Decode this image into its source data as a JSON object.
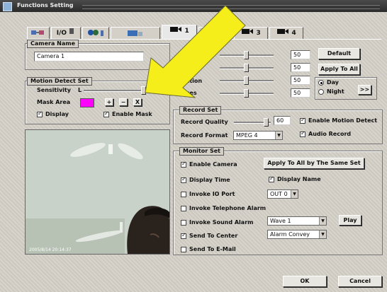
{
  "window": {
    "title": "Functions Setting"
  },
  "tabs": [
    {
      "label": "",
      "icon": "network-icon"
    },
    {
      "label": "I/O",
      "icon": "io-icon"
    },
    {
      "label": "",
      "icon": "users-icon"
    },
    {
      "label": "",
      "icon": "monitor-icon"
    },
    {
      "label": "1",
      "icon": "camera-icon"
    },
    {
      "label": "",
      "icon": "camera-icon"
    },
    {
      "label": "3",
      "icon": "camera-icon"
    },
    {
      "label": "4",
      "icon": "camera-icon"
    }
  ],
  "camera_name": {
    "group_label": "Camera Name",
    "value": "Camera 1"
  },
  "motion_detect": {
    "group_label": "Motion Detect Set",
    "sensitivity_label": "Sensitivity",
    "sensitivity_min": "L",
    "sensitivity_max": "H",
    "sensitivity_level": 0.95,
    "mask_area_label": "Mask Area",
    "mask_color": "#ff00ff",
    "plus_label": "+",
    "minus_label": "−",
    "clear_label": "X",
    "display_label": "Display",
    "display_checked": true,
    "enable_mask_label": "Enable Mask",
    "enable_mask_checked": true
  },
  "image_adjust": {
    "rows": [
      {
        "label": "",
        "value": "50"
      },
      {
        "label": "st",
        "value": "50"
      },
      {
        "label": "ration",
        "value": "50"
      },
      {
        "label": "Hues",
        "value": "50"
      }
    ],
    "default_label": "Default",
    "apply_all_label": "Apply To All",
    "day_label": "Day",
    "night_label": "Night",
    "day_selected": true,
    "more_label": ">>"
  },
  "record_set": {
    "group_label": "Record Set",
    "quality_label": "Record Quality",
    "quality_value": "60",
    "format_label": "Record Format",
    "format_value": "MPEG 4",
    "enable_motion_label": "Enable Motion Detect",
    "enable_motion_checked": true,
    "audio_record_label": "Audio Record",
    "audio_record_checked": true
  },
  "monitor_set": {
    "group_label": "Monitor Set",
    "enable_camera_label": "Enable Camera",
    "apply_same_label": "Apply To All by The Same Set",
    "display_time_label": "Display Time",
    "display_name_label": "Display Name",
    "invoke_io_label": "Invoke IO Port",
    "io_port_value": "OUT 0",
    "invoke_tel_label": "Invoke Telephone Alarm",
    "invoke_sound_label": "Invoke Sound Alarm",
    "sound_value": "Wave 1",
    "play_label": "Play",
    "send_center_label": "Send To Center",
    "center_value": "Alarm Convey",
    "send_email_label": "Send To E-Mail"
  },
  "video": {
    "timestamp": "2005/8/14 20:14:37"
  },
  "footer": {
    "ok_label": "OK",
    "cancel_label": "Cancel"
  },
  "annotation": {
    "arrow_color": "#f5ee1a"
  }
}
